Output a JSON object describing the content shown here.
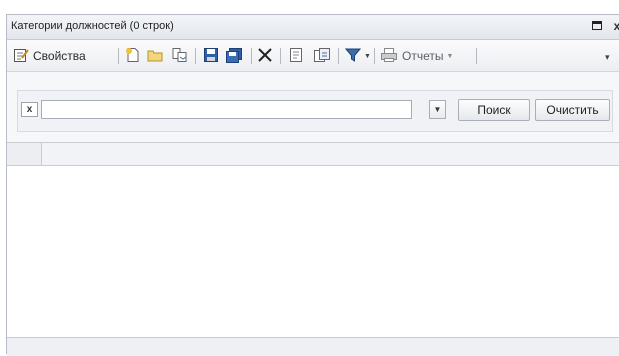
{
  "window": {
    "title": "Категории должностей (0 строк)",
    "restore_icon": "restore-icon",
    "close_icon": "close-icon",
    "close_glyph": "x"
  },
  "toolbar": {
    "properties_label": "Свойства",
    "reports_label": "Отчеты",
    "icons": [
      "properties-icon",
      "new-icon",
      "folder-icon",
      "copy-icon",
      "save-icon",
      "save-all-icon",
      "delete-icon",
      "edit-icon",
      "export-icon",
      "filter-icon",
      "print-icon"
    ],
    "overflow_glyph": "▾"
  },
  "search": {
    "clear_x": "x",
    "input_value": "",
    "search_button": "Поиск",
    "clear_button": "Очистить"
  },
  "colors": {
    "accent": "#3c6ea8",
    "border": "#b8bcc4"
  }
}
